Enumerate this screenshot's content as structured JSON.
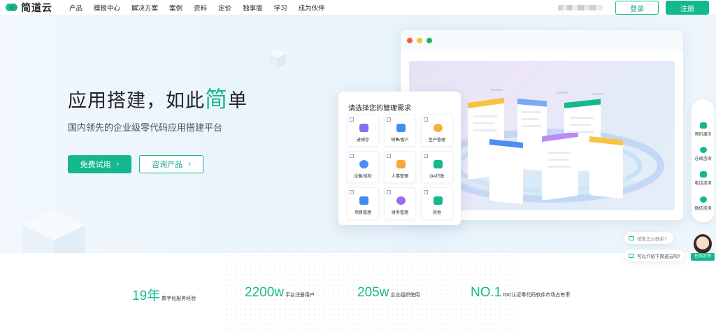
{
  "header": {
    "logo_text": "简道云",
    "nav": [
      "产品",
      "模板中心",
      "解决方案",
      "案例",
      "资料",
      "定价",
      "独享版",
      "学习",
      "成为伙伴"
    ],
    "login_label": "登录",
    "register_label": "注册"
  },
  "hero": {
    "title_prefix": "应用搭建，如此",
    "title_highlight": "简",
    "title_suffix": "单",
    "subtitle": "国内领先的企业级零代码应用搭建平台",
    "primary_button": "免费试用",
    "secondary_button": "咨询产品"
  },
  "selector": {
    "title": "请选择您的管理需求",
    "options": [
      {
        "label": "进销存",
        "color": "#8b6cf0"
      },
      {
        "label": "销售/客户",
        "color": "#3d8ef0"
      },
      {
        "label": "生产管理",
        "color": "#f5b23a"
      },
      {
        "label": "设备/巡检",
        "color": "#4f8df5"
      },
      {
        "label": "人事管理",
        "color": "#f5a93a"
      },
      {
        "label": "OA行政",
        "color": "#19b88c"
      },
      {
        "label": "项目管理",
        "color": "#3d8ef0"
      },
      {
        "label": "财务管理",
        "color": "#9b6cf0"
      },
      {
        "label": "其他",
        "color": "#19b88c"
      }
    ]
  },
  "side_toolbar": [
    "预约演示",
    "在线咨询",
    "电话咨询",
    "微信咨询"
  ],
  "chat": {
    "bubble1": "销售怎么联系?",
    "bubble2": "可以介绍下简道云吗?",
    "agent_label": "在线咨询"
  },
  "stats": [
    {
      "num": "19年",
      "label": "数字化服务经验"
    },
    {
      "num": "2200w",
      "label": "平台注册用户"
    },
    {
      "num": "205w",
      "label": "企业组织使用"
    },
    {
      "num": "NO.1",
      "label": "IDC认证零代码软件市场占有率"
    }
  ],
  "colors": {
    "brand": "#14b88e"
  }
}
